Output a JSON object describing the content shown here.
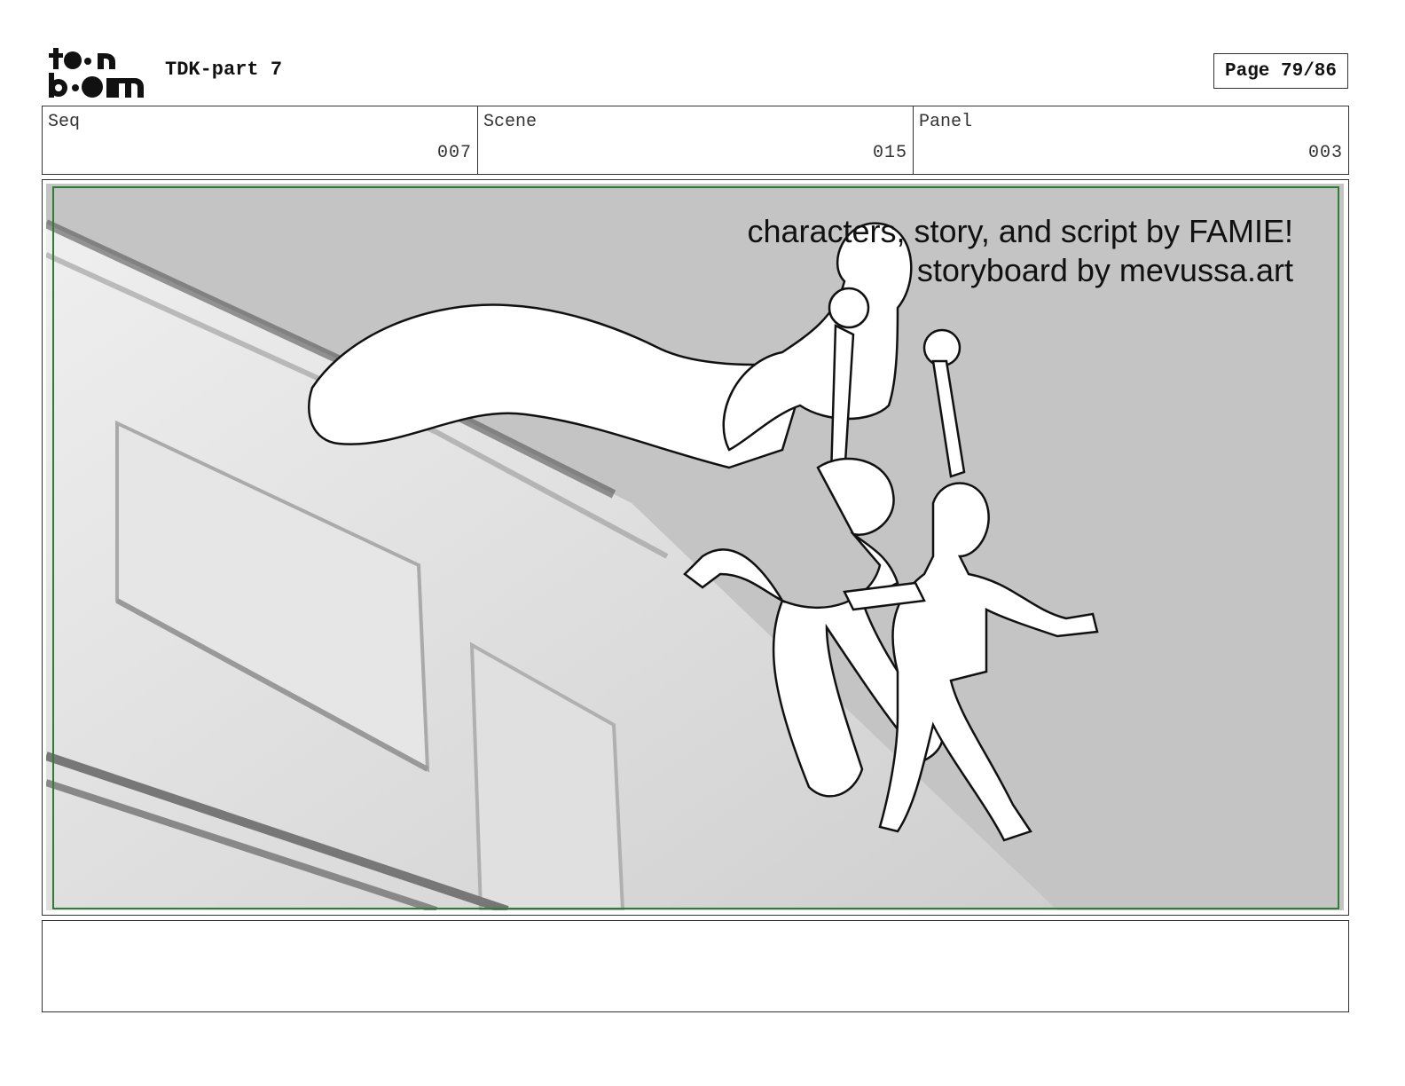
{
  "header": {
    "project_title": "TDK-part 7",
    "page_label": "Page 79/86"
  },
  "info": {
    "seq_label": "Seq",
    "seq_value": "007",
    "scene_label": "Scene",
    "scene_value": "015",
    "panel_label": "Panel",
    "panel_value": "003"
  },
  "panel": {
    "credit_line_1": "characters, story, and script by FAMIE!",
    "credit_line_2": "storyboard by mevussa.art",
    "frame_color": "#2e7d32",
    "background_color": "#c4c4c4"
  },
  "notes": {
    "text": ""
  }
}
